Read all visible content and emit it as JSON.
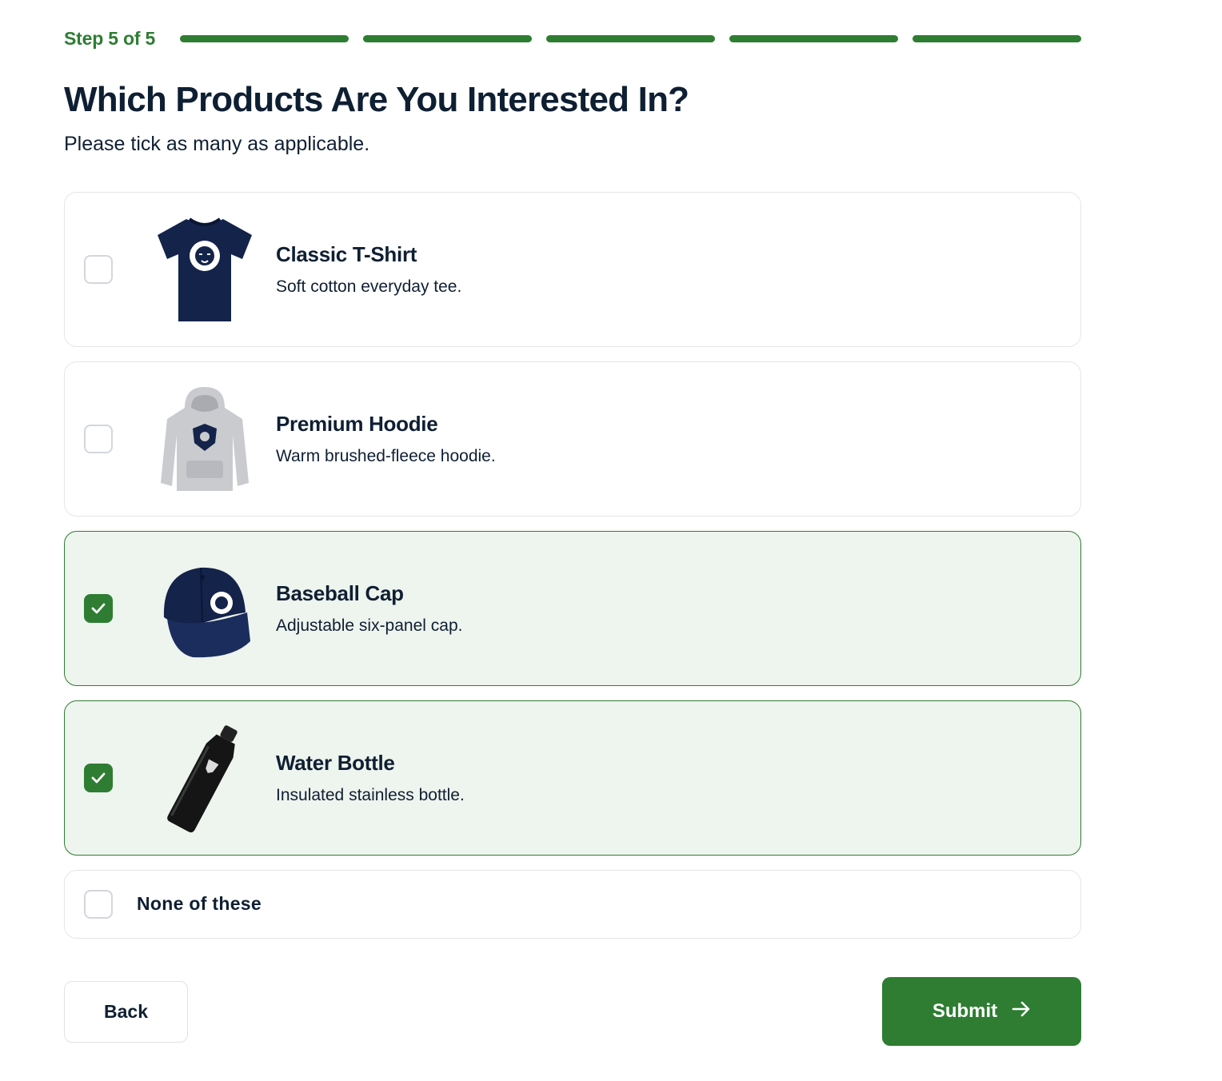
{
  "step": {
    "label": "Step 5 of 5",
    "current": 5,
    "total": 5
  },
  "title": "Which Products Are You Interested In?",
  "subtitle": "Please tick as many as applicable.",
  "options": [
    {
      "name": "Classic T-Shirt",
      "description": "Soft cotton everyday tee.",
      "checked": false,
      "icon": "tshirt-image"
    },
    {
      "name": "Premium Hoodie",
      "description": "Warm brushed-fleece hoodie.",
      "checked": false,
      "icon": "hoodie-image"
    },
    {
      "name": "Baseball Cap",
      "description": "Adjustable six-panel cap.",
      "checked": true,
      "icon": "cap-image"
    },
    {
      "name": "Water Bottle",
      "description": "Insulated stainless bottle.",
      "checked": true,
      "icon": "bottle-image"
    }
  ],
  "none_option": {
    "label": "None of these",
    "checked": false
  },
  "buttons": {
    "back": "Back",
    "submit": "Submit"
  },
  "colors": {
    "accent": "#2e7d32",
    "selected_bg": "#eef4ee",
    "text": "#0f1f33",
    "product_navy": "#14234a"
  }
}
